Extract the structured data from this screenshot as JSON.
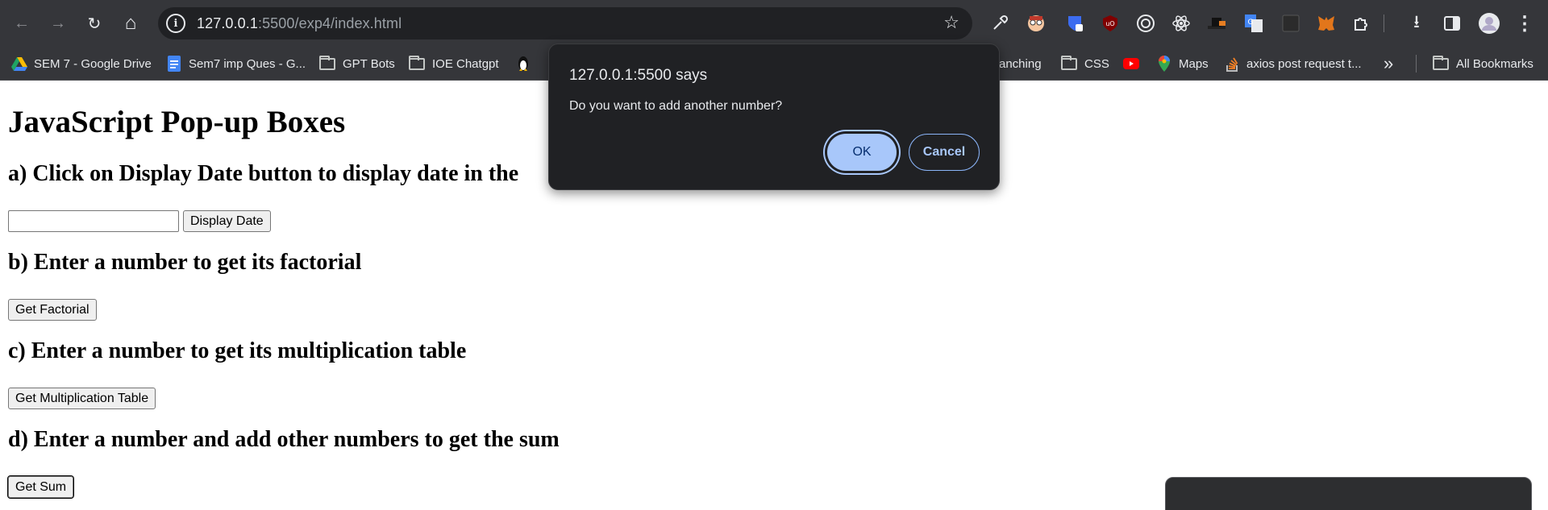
{
  "browser": {
    "url_host": "127.0.0.1",
    "url_rest": ":5500/exp4/index.html",
    "icons": {
      "back": "←",
      "forward": "→",
      "reload": "↻",
      "home": "⌂",
      "site_info": "i",
      "star": "☆",
      "menu": "⋮",
      "download": "⭳",
      "more": "»"
    }
  },
  "bookmarks": [
    {
      "label": "SEM 7 - Google Drive",
      "icon": "drive-icon"
    },
    {
      "label": "Sem7 imp Ques - G...",
      "icon": "docs-icon"
    },
    {
      "label": "GPT Bots",
      "icon": "folder-icon"
    },
    {
      "label": "IOE Chatgpt",
      "icon": "folder-icon"
    },
    {
      "label": "anching",
      "icon": ""
    },
    {
      "label": "CSS",
      "icon": "folder-icon"
    },
    {
      "label": "Maps",
      "icon": "maps-icon"
    },
    {
      "label": "axios post request t...",
      "icon": "stackoverflow-icon"
    },
    {
      "label": "All Bookmarks",
      "icon": "folder-icon"
    }
  ],
  "page": {
    "title": "JavaScript Pop-up Boxes",
    "section_a": "a) Click on Display Date button to display date in the",
    "date_value": "",
    "display_date_button": "Display Date",
    "section_b": "b) Enter a number to get its factorial",
    "factorial_button": "Get Factorial",
    "section_c": "c) Enter a number to get its multiplication table",
    "table_button": "Get Multiplication Table",
    "section_d": "d) Enter a number and add other numbers to get the sum",
    "sum_button": "Get Sum"
  },
  "dialog": {
    "title": "127.0.0.1:5500 says",
    "message": "Do you want to add another number?",
    "ok": "OK",
    "cancel": "Cancel"
  },
  "colors": {
    "chrome_bg": "#35363a",
    "omnibox_bg": "#202124",
    "dialog_bg": "#202124",
    "ok_bg": "#a8c7fa",
    "cancel_border": "#8ab4f8"
  }
}
